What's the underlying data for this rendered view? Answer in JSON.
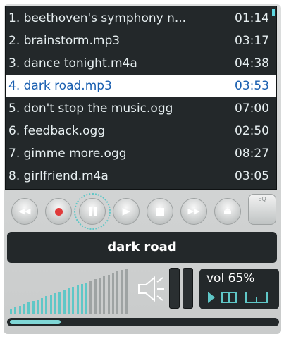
{
  "playlist": {
    "tracks": [
      {
        "name": "1. beethoven's symphony n...",
        "time": "01:14"
      },
      {
        "name": "2. brainstorm.mp3",
        "time": "03:17"
      },
      {
        "name": "3. dance tonight.m4a",
        "time": "04:38"
      },
      {
        "name": "4. dark road.mp3",
        "time": "03:53"
      },
      {
        "name": "5. don't stop the music.ogg",
        "time": "07:00"
      },
      {
        "name": "6. feedback.ogg",
        "time": "02:50"
      },
      {
        "name": "7. gimme more.ogg",
        "time": "08:27"
      },
      {
        "name": "8. girlfriend.m4a",
        "time": "03:05"
      }
    ],
    "selected_index": 3
  },
  "controls": {
    "rewind_icon": "rewind-icon",
    "record_icon": "record-icon",
    "pause_icon": "pause-icon",
    "play_icon": "play-icon",
    "stop_icon": "stop-icon",
    "fastforward_icon": "fast-forward-icon",
    "eject_icon": "eject-icon",
    "eq_label": "EQ"
  },
  "now_playing": {
    "title": "dark road"
  },
  "volume": {
    "text": "vol 65%",
    "level": 0.65
  },
  "progress": {
    "fraction": 0.19
  },
  "colors": {
    "accent": "#5fc7c7",
    "screen": "#23282a",
    "selected_text": "#1a5fb0",
    "record": "#e03a3a"
  }
}
